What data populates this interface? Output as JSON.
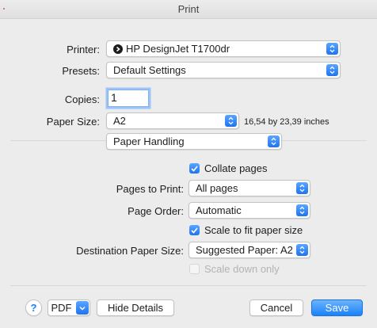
{
  "window": {
    "title": "Print"
  },
  "printer": {
    "label": "Printer:",
    "value": "HP DesignJet T1700dr"
  },
  "presets": {
    "label": "Presets:",
    "value": "Default Settings"
  },
  "copies": {
    "label": "Copies:",
    "value": "1"
  },
  "paper_size": {
    "label": "Paper Size:",
    "value": "A2",
    "dimensions": "16,54 by 23,39 inches"
  },
  "panel_selector": {
    "value": "Paper Handling"
  },
  "collate": {
    "label": "Collate pages",
    "checked": true
  },
  "pages_to_print": {
    "label": "Pages to Print:",
    "value": "All pages"
  },
  "page_order": {
    "label": "Page Order:",
    "value": "Automatic"
  },
  "scale_to_fit": {
    "label": "Scale to fit paper size",
    "checked": true
  },
  "destination_paper_size": {
    "label": "Destination Paper Size:",
    "value": "Suggested Paper: A2"
  },
  "scale_down_only": {
    "label": "Scale down only",
    "checked": false,
    "disabled": true
  },
  "footer": {
    "help_label": "?",
    "pdf_label": "PDF",
    "hide_details_label": "Hide Details",
    "cancel_label": "Cancel",
    "save_label": "Save"
  },
  "colors": {
    "accent": "#1a82fb",
    "background": "#ececec"
  }
}
